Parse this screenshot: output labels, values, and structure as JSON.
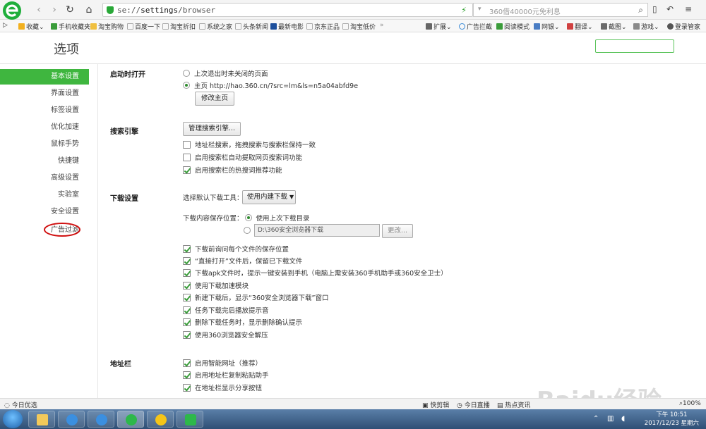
{
  "browser": {
    "address_url_prefix": "se://",
    "address_url_main": "settings",
    "address_url_suffix": "/browser",
    "search_placeholder": "360借40000元免利息"
  },
  "bookmarks": [
    {
      "label": "收藏",
      "color": "#f2b01e"
    },
    {
      "label": "手机收藏夹",
      "color": "#3a9c3a"
    },
    {
      "label": "淘宝购物",
      "color": "#f0c040"
    },
    {
      "label": "百度一下",
      "color": "#cfcfcf"
    },
    {
      "label": "淘宝折扣",
      "color": "#cfcfcf"
    },
    {
      "label": "系统之家",
      "color": "#cfcfcf"
    },
    {
      "label": "头条新闻",
      "color": "#cfcfcf"
    },
    {
      "label": "最新电影",
      "color": "#1d4f9c"
    },
    {
      "label": "京东正品",
      "color": "#cfcfcf"
    },
    {
      "label": "淘宝低价",
      "color": "#cfcfcf"
    }
  ],
  "extensions": [
    "扩展",
    "广告拦截",
    "阅读模式",
    "网银",
    "翻译",
    "截图",
    "游戏",
    "登录管家"
  ],
  "page": {
    "title": "选项"
  },
  "sidebar": [
    {
      "label": "基本设置",
      "active": true
    },
    {
      "label": "界面设置"
    },
    {
      "label": "标签设置"
    },
    {
      "label": "优化加速"
    },
    {
      "label": "鼠标手势"
    },
    {
      "label": "快捷键"
    },
    {
      "label": "高级设置"
    },
    {
      "label": "实验室"
    },
    {
      "label": "安全设置"
    },
    {
      "label": "广告过滤"
    }
  ],
  "startup": {
    "label": "启动时打开",
    "opt_last": "上次退出时未关闭的页面",
    "opt_home": "主页   http://hao.360.cn/?src=lm&ls=n5a04abfd9e",
    "modify_button": "修改主页"
  },
  "search_engine": {
    "label": "搜索引擎",
    "manage_button": "管理搜索引擎...",
    "options": [
      {
        "label": "地址栏搜索，拖拽搜索与搜索栏保持一致",
        "checked": false
      },
      {
        "label": "启用搜索栏自动提取网页搜索词功能",
        "checked": false
      },
      {
        "label": "启用搜索栏的热搜词推荐功能",
        "checked": true
      }
    ]
  },
  "download": {
    "label": "下载设置",
    "tool_label": "选择默认下载工具：",
    "tool_value": "使用内建下载",
    "save_label": "下载内容保存位置：",
    "save_last": "使用上次下载目录",
    "save_path": "D:\\360安全浏览器下载",
    "change_button": "更改...",
    "options": [
      {
        "label": "下载前询问每个文件的保存位置",
        "checked": true
      },
      {
        "label": "“直接打开”文件后，保留已下载文件",
        "checked": true
      },
      {
        "label": "下载apk文件时，提示一键安装到手机（电脑上需安装360手机助手或360安全卫士）",
        "checked": true
      },
      {
        "label": "使用下载加速模块",
        "checked": true
      },
      {
        "label": "新建下载后，显示“360安全浏览器下载”窗口",
        "checked": true
      },
      {
        "label": "任务下载完后播放提示音",
        "checked": true
      },
      {
        "label": "删除下载任务时，显示删除确认提示",
        "checked": true
      },
      {
        "label": "使用360浏览器安全解压",
        "checked": true
      }
    ]
  },
  "addressbar": {
    "label": "地址栏",
    "options": [
      {
        "label": "启用智能网址（推荐）",
        "checked": true
      },
      {
        "label": "启用地址栏复制粘贴助手",
        "checked": true
      },
      {
        "label": "在地址栏显示分享按钮",
        "checked": true
      }
    ]
  },
  "statusbar": {
    "left": "今日优选",
    "quick_clip": "快剪辑",
    "today_live": "今日直播",
    "hot_news": "热点资讯",
    "zoom": "100%"
  },
  "clock": {
    "time": "下午 10:51",
    "date": "2017/12/23 星期六"
  },
  "watermark": "Baidu经验"
}
